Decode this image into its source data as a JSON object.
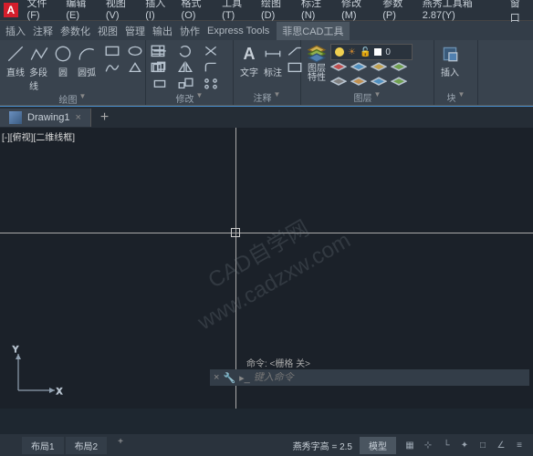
{
  "app": {
    "letter": "A"
  },
  "menubar": {
    "file": "文件(F)",
    "edit": "编辑(E)",
    "view": "视图(V)",
    "insert": "插入(I)",
    "format": "格式(O)",
    "tools": "工具(T)",
    "draw": "绘图(D)",
    "annotate": "标注(N)",
    "modify": "修改(M)",
    "param": "参数(P)",
    "yxtools": "燕秀工具箱2.87(Y)",
    "window": "窗口"
  },
  "ribbontabs": {
    "insert": "插入",
    "anno": "注释",
    "param": "参数化",
    "view": "视图",
    "manage": "管理",
    "output": "输出",
    "collab": "协作",
    "express": "Express Tools",
    "cad": "菲思CAD工具"
  },
  "draw": {
    "line": "直线",
    "pline": "多段线",
    "circle": "圆",
    "arc": "圆弧",
    "panel": "绘图"
  },
  "modify": {
    "panel": "修改"
  },
  "anno": {
    "text": "文字",
    "dim": "标注",
    "panel": "注释"
  },
  "layer": {
    "props": "图层\n特性",
    "panel": "图层",
    "current": "0"
  },
  "block": {
    "insert": "插入",
    "panel": "块"
  },
  "doc": {
    "name": "Drawing1",
    "viewlabel": "[-][俯视][二维线框]"
  },
  "watermark": {
    "line1": "CAD自学网",
    "line2": "www.cadzxw.com"
  },
  "ucs": {
    "x": "X",
    "y": "Y"
  },
  "cmd": {
    "hist": "命令: <栅格 关>",
    "placeholder": "键入命令"
  },
  "layouts": {
    "l1": "布局1",
    "l2": "布局2"
  },
  "status": {
    "model": "模型",
    "textheight": "燕秀字高 = 2.5"
  }
}
